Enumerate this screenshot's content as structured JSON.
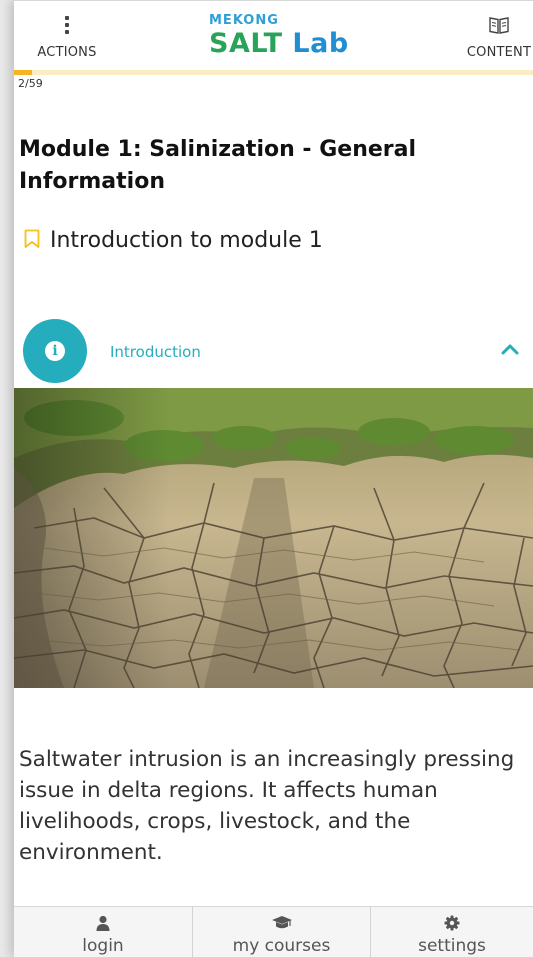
{
  "header": {
    "actions_label": "ACTIONS",
    "content_label": "CONTENT",
    "logo_top": "MEKONG",
    "logo_main_a": "SALT",
    "logo_main_b": "Lab"
  },
  "progress": {
    "counter": "2/59",
    "current": 2,
    "total": 59
  },
  "module": {
    "title": "Module 1: Salinization - General Information"
  },
  "lesson": {
    "title": "Introduction to module 1",
    "icon": "bookmark-icon"
  },
  "section": {
    "label": "Introduction",
    "icon": "info-icon",
    "state_icon": "chevron-up-icon"
  },
  "body": {
    "text": "Saltwater intrusion is an increasingly pressing issue in delta regions. It affects human livelihoods, crops, livestock, and the environment."
  },
  "bottom_nav": {
    "items": [
      {
        "label": "login",
        "icon": "user-icon"
      },
      {
        "label": "my courses",
        "icon": "graduation-cap-icon"
      },
      {
        "label": "settings",
        "icon": "gear-icon"
      }
    ]
  },
  "colors": {
    "accent": "#26adbd",
    "progress_fill": "#f4b423",
    "progress_track": "#faedc4",
    "logo_green": "#2aa35a",
    "logo_blue": "#1f8ed2"
  }
}
